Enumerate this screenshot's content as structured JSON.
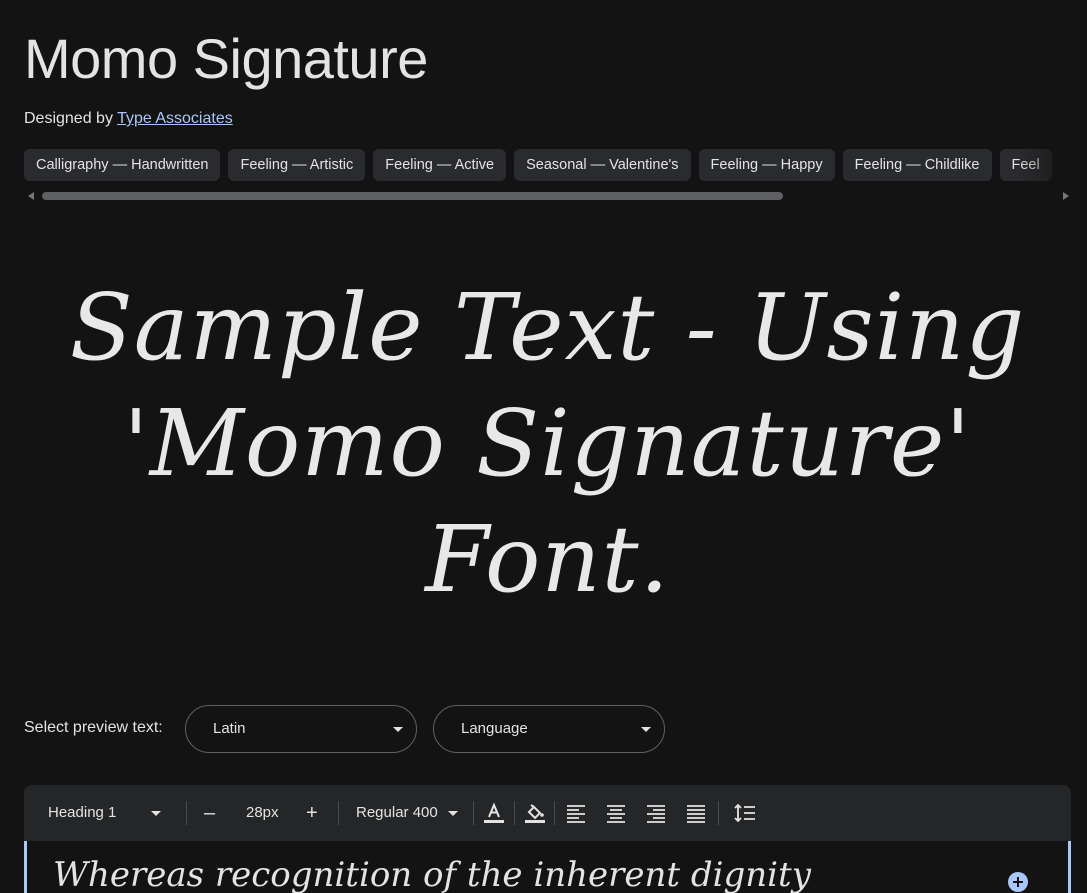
{
  "header": {
    "title": "Momo Signature",
    "designed_by_label": "Designed by",
    "designer_name": "Type Associates"
  },
  "tags": [
    "Calligraphy — Handwritten",
    "Feeling — Artistic",
    "Feeling — Active",
    "Seasonal — Valentine's",
    "Feeling — Happy",
    "Feeling — Childlike",
    "Feel"
  ],
  "preview": {
    "line1": "Sample Text - Using",
    "line2": "'Momo Signature'",
    "line3": "Font."
  },
  "preview_controls": {
    "label": "Select preview text:",
    "script_value": "Latin",
    "language_value": "Language"
  },
  "toolbar": {
    "style_value": "Heading 1",
    "size_value": "28px",
    "weight_value": "Regular 400",
    "decrease_symbol": "–",
    "increase_symbol": "+"
  },
  "editor": {
    "text": "Whereas recognition of the inherent dignity"
  },
  "colors": {
    "background": "#131313",
    "chip_background": "#2a2b2e",
    "link": "#a8c7fa",
    "toolbar_background": "#252628"
  }
}
